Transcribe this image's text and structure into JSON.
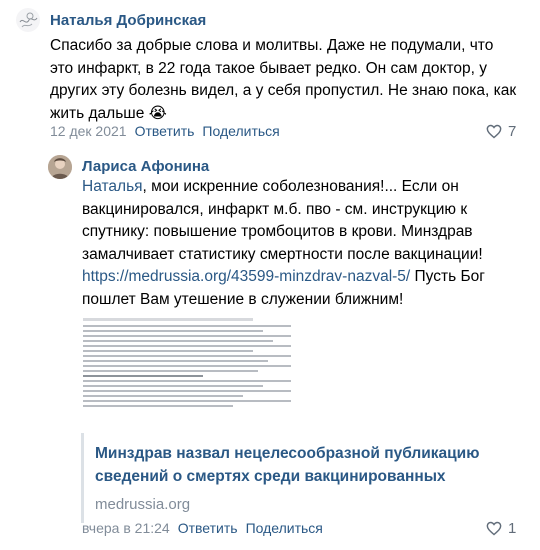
{
  "comments": [
    {
      "author": "Наталья Добринская",
      "text": "Спасибо за добрые слова и молитвы. Даже не подумали, что это инфаркт, в 22 года такое бывает редко. Он сам доктор, у других эту болезнь видел, а у себя пропустил. Не знаю пока, как жить дальше",
      "emoji": "😭",
      "date": "12 дек 2021",
      "reply_label": "Ответить",
      "share_label": "Поделиться",
      "likes": "7"
    },
    {
      "author": "Лариса Афонина",
      "mention": "Наталья",
      "text_part1": ", мои искренние соболезнования!... Если он вакцинировался, инфаркт м.б. пво - см. инструкцию к спутнику: повышение тромбоцитов в крови. Минздрав замалчивает статистику смертности после вакцинации! ",
      "link": "https://medrussia.org/43599-minzdrav-nazval-5/",
      "text_part2": " Пусть Бог пошлет Вам утешение в служении ближним!",
      "date": "вчера в 21:24",
      "reply_label": "Ответить",
      "share_label": "Поделиться",
      "likes": "1"
    }
  ],
  "snippet": {
    "title": "Минздрав назвал нецелесообразной публикацию сведений о смертях среди вакцинированных",
    "domain": "medrussia.org"
  },
  "icons": {
    "like": "heart-outline-icon"
  },
  "colors": {
    "link": "#2a5885",
    "meta": "#818c99"
  }
}
